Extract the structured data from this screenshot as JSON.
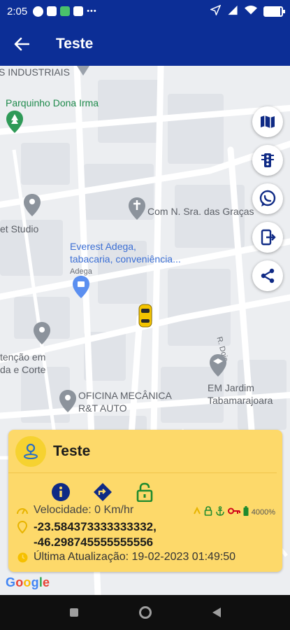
{
  "status_bar": {
    "time": "2:05",
    "dots": "•••",
    "battery_percent": 0.9
  },
  "app_bar": {
    "title": "Teste",
    "back_icon": "arrow-left-icon"
  },
  "map": {
    "labels": {
      "industriais": "S INDUSTRIAIS",
      "parquinho": "Parquinho Dona Irma",
      "com_sra": "Com N. Sra. das Graças",
      "et_studio": "et Studio",
      "everest_line1": "Everest Adega,",
      "everest_line2": "tabacaria, conveniência...",
      "adega": "Adega",
      "r_dois": "R. Dois",
      "atencao_line1": "tenção em",
      "atencao_line2": "da e Corte",
      "em_jardim_line1": "EM Jardim",
      "em_jardim_line2": "Tabamarajoara",
      "oficina_line1": "OFICINA MECÂNICA",
      "oficina_line2": "R&T AUTO"
    },
    "fab_buttons": [
      "map-icon",
      "traffic-light-icon",
      "whatsapp-icon",
      "exit-icon",
      "share-icon"
    ]
  },
  "card": {
    "title": "Teste",
    "speed": "Velocidade: 0 Km/hr",
    "coord_lat": "-23.584373333333332,",
    "coord_lng": "-46.298745555555556",
    "last_update": "Última Atualização: 19-02-2023 01:49:50",
    "battery_level": "4000%"
  },
  "google": {
    "g1": "G",
    "g2": "o",
    "g3": "o",
    "g4": "g",
    "g5": "l",
    "g6": "e"
  },
  "colors": {
    "primary": "#0c2e96",
    "card": "#fdd96a",
    "icon_navy": "#0f2a85",
    "icon_green": "#1e8a2e"
  }
}
